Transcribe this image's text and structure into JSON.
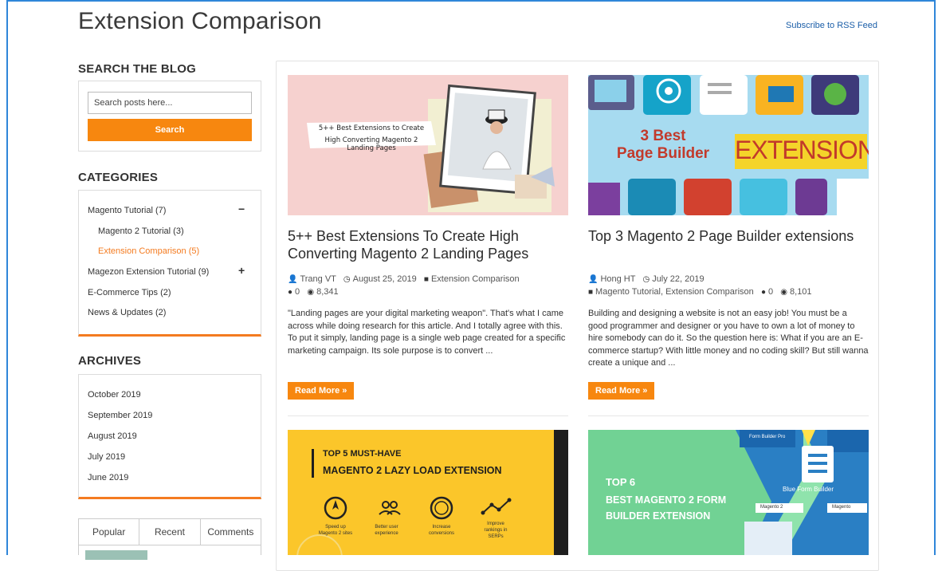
{
  "header": {
    "title": "Extension Comparison",
    "rss_link": "Subscribe to RSS Feed"
  },
  "sidebar": {
    "search": {
      "title": "SEARCH THE BLOG",
      "placeholder": "Search posts here...",
      "button_label": "Search"
    },
    "categories": {
      "title": "CATEGORIES",
      "items": [
        {
          "label": "Magento Tutorial (7)",
          "toggle": "−"
        },
        {
          "label": "Magento 2 Tutorial (3)"
        },
        {
          "label": "Extension Comparison (5)",
          "active": true
        },
        {
          "label": "Magezon Extension Tutorial (9)",
          "toggle": "+"
        },
        {
          "label": "E-Commerce Tips (2)"
        },
        {
          "label": "News & Updates (2)"
        }
      ]
    },
    "archives": {
      "title": "ARCHIVES",
      "items": [
        "October 2019",
        "September 2019",
        "August 2019",
        "July 2019",
        "June 2019"
      ]
    },
    "tabs": [
      "Popular",
      "Recent",
      "Comments"
    ]
  },
  "posts": [
    {
      "image_caption_line1": "5++ Best Extensions to Create",
      "image_caption_line2": "High Converting Magento 2 Landing Pages",
      "title": "5++ Best Extensions To Create High Converting Magento 2 Landing Pages",
      "author": "Trang VT",
      "date": "August 25, 2019",
      "category": "Extension Comparison",
      "comments": "0",
      "views": "8,341",
      "excerpt": "\"Landing pages are your digital marketing weapon\". That's what I came across while doing research for this article. And I totally agree with this. To put it simply, landing page is a single web page created for a specific marketing campaign. Its sole purpose is to convert ...",
      "read_more": "Read More »"
    },
    {
      "image_text_1": "3 Best",
      "image_text_2": "Page Builder",
      "image_text_3": "EXTENSIONS",
      "title": "Top 3 Magento 2 Page Builder extensions",
      "author": "Hong HT",
      "date": "July 22, 2019",
      "category": "Magento Tutorial, Extension Comparison",
      "comments": "0",
      "views": "8,101",
      "excerpt": "Building and designing a website is not an easy job! You must be a good programmer and designer or you have to own a lot of money to hire somebody can do it. So the question here is: What if you are an E-commerce startup? With little money and no coding skill? But still wanna create a unique and ...",
      "read_more": "Read More »"
    },
    {
      "image_line1": "TOP 5 MUST-HAVE",
      "image_line2": "MAGENTO 2 LAZY LOAD EXTENSION",
      "features": [
        "Speed up Magento 2 sites",
        "Better user experience",
        "Increase conversions",
        "Improve rankings in SERPs"
      ]
    },
    {
      "image_line1": "TOP 6",
      "image_line2": "BEST MAGENTO 2 FORM",
      "image_line3": "BUILDER EXTENSION",
      "badge1": "Blue Form Builder",
      "badge2": "Form Builder Pro",
      "badge3": "Magento 2",
      "badge4": "Magento"
    }
  ],
  "colors": {
    "accent": "#f7870f",
    "link": "#1b5ea8",
    "frame": "#2f86d9"
  }
}
